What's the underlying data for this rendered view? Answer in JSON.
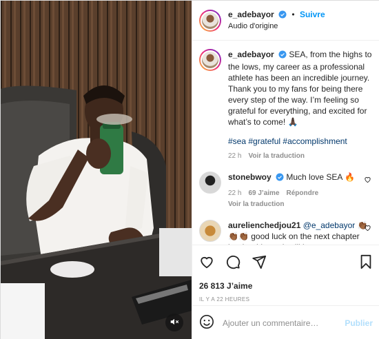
{
  "header": {
    "username": "e_adebayor",
    "follow_label": "Suivre",
    "subtitle": "Audio d'origine"
  },
  "caption": {
    "username": "e_adebayor",
    "text": "SEA, from the highs to the lows, my career as a professional athlete has been an incredible journey. Thank you to my fans for being there every step of the way. I’m feeling so grateful for everything, and excited for what’s to come! 🙏🏿",
    "hashtags": "#sea #grateful #accomplishment",
    "age": "22 h",
    "translate_label": "Voir la traduction"
  },
  "comments": [
    {
      "username": "stonebwoy",
      "text": "Much love SEA 🔥",
      "age": "22 h",
      "likes": "69 J’aime",
      "reply_label": "Répondre",
      "translate_label": "Voir la traduction"
    },
    {
      "username": "aurelienchedjou21",
      "mention": "@e_adebayor",
      "text": "👏🏾 👏🏾👏🏾 good luck on the next chapter brother,I know it will be"
    }
  ],
  "post": {
    "likes": "26 813 J’aime",
    "timestamp": "IL Y A 22 HEURES"
  },
  "add_comment": {
    "placeholder": "Ajouter un commentaire…",
    "post_label": "Publier"
  },
  "icons": {
    "verified": "verified-badge-icon",
    "like": "heart-icon",
    "comment": "comment-icon",
    "share": "paper-plane-icon",
    "save": "bookmark-icon",
    "emoji": "emoji-icon",
    "mute": "speaker-muted-icon"
  },
  "colors": {
    "accent": "#0095f6",
    "verified": "#3897f0",
    "hashtag": "#00376b",
    "muted_text": "#8e8e8e",
    "publish_disabled": "#b2dffc"
  }
}
